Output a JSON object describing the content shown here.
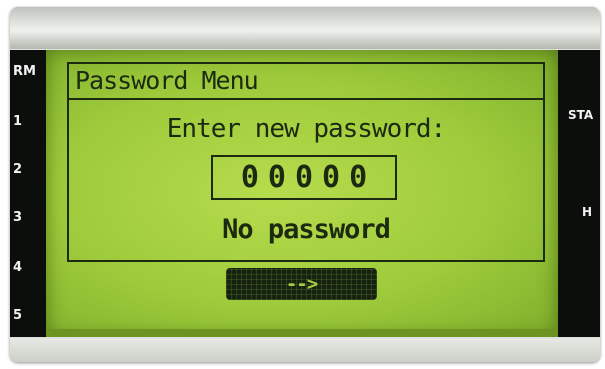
{
  "device": {
    "left_labels": [
      "RM",
      "1",
      "2",
      "3",
      "4",
      "5"
    ],
    "right_labels": [
      "STA",
      "H"
    ]
  },
  "screen": {
    "title": "Password Menu",
    "prompt": "Enter new password:",
    "password_value": "00000",
    "status": "No password",
    "next_button_label": "-->"
  },
  "colors": {
    "lcd_background": "#9ecb3b",
    "lcd_text": "#1d2a12",
    "bezel": "#0c0e0c",
    "button_fill": "#162210",
    "button_text": "#a4cd44"
  }
}
